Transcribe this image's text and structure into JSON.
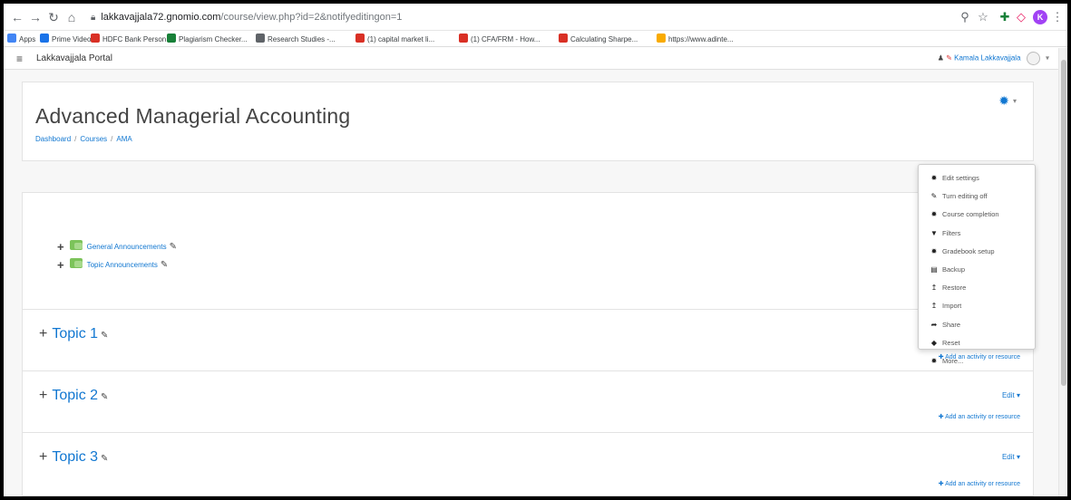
{
  "browser": {
    "url_host": "lakkavajjala72.gnomio.com",
    "url_path": "/course/view.php?id=2&notifyeditingon=1",
    "bookmarks": [
      {
        "label": "Apps",
        "color": "#4285f4"
      },
      {
        "label": "Prime Video",
        "color": "#1a73e8"
      },
      {
        "label": "HDFC Bank Person...",
        "color": "#d93025"
      },
      {
        "label": "Plagiarism Checker...",
        "color": "#188038"
      },
      {
        "label": "Research Studies -...",
        "color": "#5f6368"
      },
      {
        "label": "(1) capital market li...",
        "color": "#d93025"
      },
      {
        "label": "(1) CFA/FRM - How...",
        "color": "#d93025"
      },
      {
        "label": "Calculating Sharpe...",
        "color": "#d93025"
      },
      {
        "label": "https://www.adinte...",
        "color": "#f9ab00"
      }
    ]
  },
  "navbar": {
    "site_name": "Lakkavajjala Portal",
    "user_name": "Kamala Lakkavajjala"
  },
  "course": {
    "title": "Advanced Managerial Accounting",
    "breadcrumb": [
      "Dashboard",
      "Courses",
      "AMA"
    ]
  },
  "activities": [
    "General Announcements",
    "Topic Announcements"
  ],
  "sections": [
    {
      "title": "Topic 1",
      "edit": "",
      "add": "Add an activity or resource"
    },
    {
      "title": "Topic 2",
      "edit": "Edit",
      "add": "Add an activity or resource"
    },
    {
      "title": "Topic 3",
      "edit": "Edit",
      "add": "Add an activity or resource"
    }
  ],
  "menu": [
    {
      "label": "Edit settings",
      "icon": "gear-icon",
      "glyph": "✹"
    },
    {
      "label": "Turn editing off",
      "icon": "pencil-icon",
      "glyph": "✎"
    },
    {
      "label": "Course completion",
      "icon": "gear-icon",
      "glyph": "✹"
    },
    {
      "label": "Filters",
      "icon": "filter-icon",
      "glyph": "▼"
    },
    {
      "label": "Gradebook setup",
      "icon": "gear-icon",
      "glyph": "✹"
    },
    {
      "label": "Backup",
      "icon": "file-icon",
      "glyph": "▤"
    },
    {
      "label": "Restore",
      "icon": "upload-icon",
      "glyph": "↥"
    },
    {
      "label": "Import",
      "icon": "upload-icon",
      "glyph": "↥"
    },
    {
      "label": "Share",
      "icon": "share-icon",
      "glyph": "➦"
    },
    {
      "label": "Reset",
      "icon": "reset-icon",
      "glyph": "◆"
    },
    {
      "label": "More...",
      "icon": "gear-icon",
      "glyph": "✹"
    }
  ],
  "colors": {
    "link": "#1177d1",
    "profile": "#a142f4"
  }
}
